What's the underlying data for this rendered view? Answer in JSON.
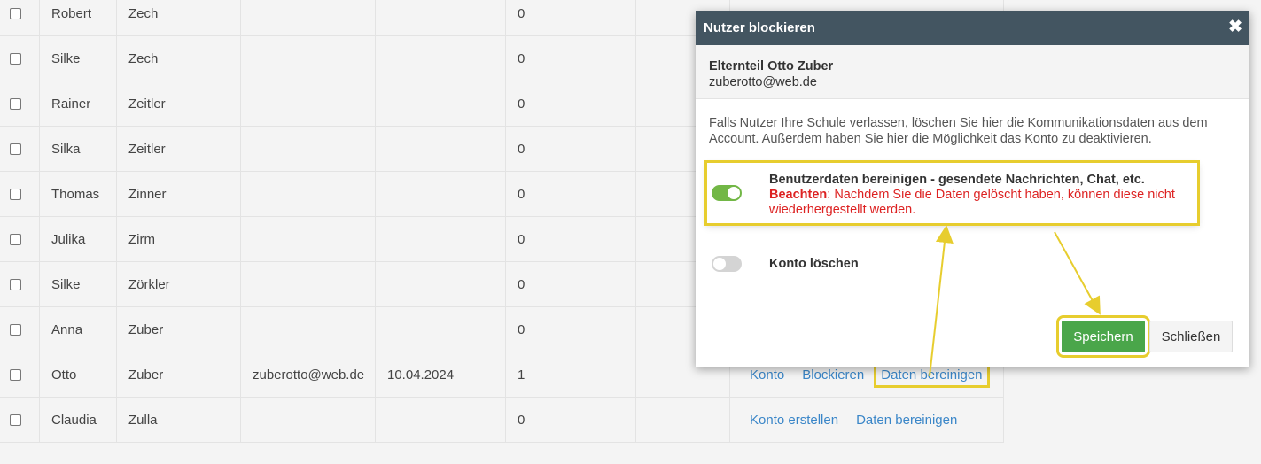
{
  "table": {
    "rows": [
      {
        "first": "Robert",
        "last": "Zech",
        "email": "",
        "date": "",
        "count": "0",
        "actions": []
      },
      {
        "first": "Silke",
        "last": "Zech",
        "email": "",
        "date": "",
        "count": "0",
        "actions": []
      },
      {
        "first": "Rainer",
        "last": "Zeitler",
        "email": "",
        "date": "",
        "count": "0",
        "actions": []
      },
      {
        "first": "Silka",
        "last": "Zeitler",
        "email": "",
        "date": "",
        "count": "0",
        "actions": []
      },
      {
        "first": "Thomas",
        "last": "Zinner",
        "email": "",
        "date": "",
        "count": "0",
        "actions": []
      },
      {
        "first": "Julika",
        "last": "Zirm",
        "email": "",
        "date": "",
        "count": "0",
        "actions": []
      },
      {
        "first": "Silke",
        "last": "Zörkler",
        "email": "",
        "date": "",
        "count": "0",
        "actions": []
      },
      {
        "first": "Anna",
        "last": "Zuber",
        "email": "",
        "date": "",
        "count": "0",
        "actions": []
      },
      {
        "first": "Otto",
        "last": "Zuber",
        "email": "zuberotto@web.de",
        "date": "10.04.2024",
        "count": "1",
        "actions": [
          "Konto",
          "Blockieren",
          "Daten bereinigen"
        ],
        "highlight_action": "Daten bereinigen"
      },
      {
        "first": "Claudia",
        "last": "Zulla",
        "email": "",
        "date": "",
        "count": "0",
        "actions": [
          "Konto erstellen",
          "Daten bereinigen"
        ]
      }
    ]
  },
  "modal": {
    "title": "Nutzer blockieren",
    "close_icon": "close-icon",
    "user_name": "Elternteil Otto Zuber",
    "user_email": "zuberotto@web.de",
    "description": "Falls Nutzer Ihre Schule verlassen, löschen Sie hier die Kommunikationsdaten aus dem Account. Außerdem haben Sie hier die Möglichkeit das Konto zu deaktivieren.",
    "option1": {
      "title": "Benutzerdaten bereinigen - gesendete Nachrichten, Chat, etc.",
      "warn_label": "Beachten",
      "warn_text": ": Nachdem Sie die Daten gelöscht haben, können diese nicht wiederhergestellt werden.",
      "enabled": true
    },
    "option2": {
      "title": "Konto löschen",
      "enabled": false
    },
    "save_label": "Speichern",
    "close_label": "Schließen"
  },
  "colors": {
    "header_bg": "#435561",
    "toggle_on": "#72b746",
    "save_bg": "#4aa64a",
    "highlight": "#e7cd2e",
    "link": "#3a86c8",
    "warning": "#dd2222"
  }
}
